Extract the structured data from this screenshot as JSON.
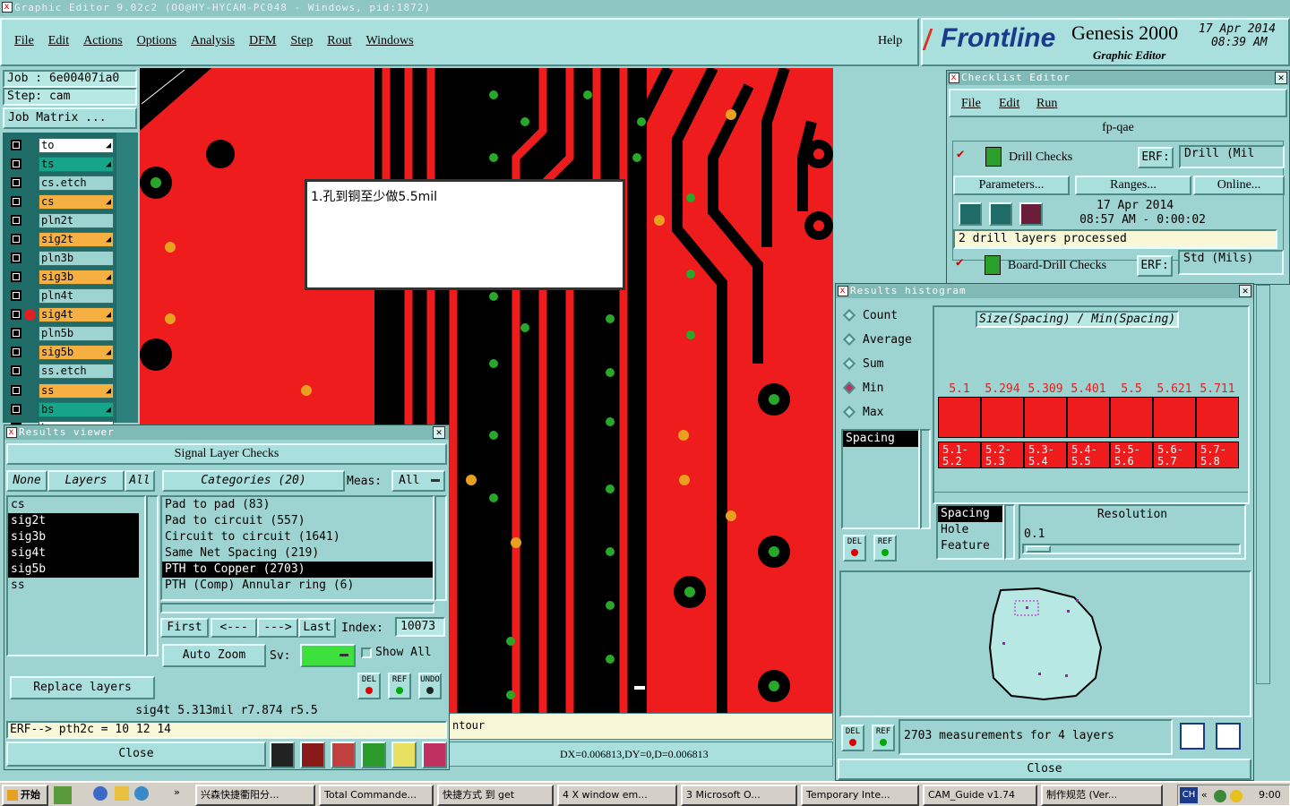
{
  "window": {
    "title": "Graphic Editor 9.02c2  (OO@HY-HYCAM-PC048 - Windows, pid:1872)"
  },
  "menu": {
    "items": [
      "File",
      "Edit",
      "Actions",
      "Options",
      "Analysis",
      "DFM",
      "Step",
      "Rout",
      "Windows"
    ],
    "help": "Help"
  },
  "brand": {
    "logo": "Frontline",
    "product": "Genesis 2000",
    "subtitle": "Graphic Editor",
    "date": "17 Apr 2014",
    "time": "08:39 AM"
  },
  "job": {
    "job_label": "Job : 6e00407ia0",
    "step_label": "Step: cam",
    "matrix_button": "Job Matrix ..."
  },
  "layers": [
    {
      "name": "to",
      "color": "#ffffff",
      "arrow": true
    },
    {
      "name": "ts",
      "color": "#17a589",
      "arrow": true
    },
    {
      "name": "cs.etch",
      "color": "#9dd3d0",
      "arrow": false
    },
    {
      "name": "cs",
      "color": "#f5b041",
      "arrow": true
    },
    {
      "name": "pln2t",
      "color": "#9dd3d0",
      "arrow": false
    },
    {
      "name": "sig2t",
      "color": "#f5b041",
      "arrow": true
    },
    {
      "name": "pln3b",
      "color": "#9dd3d0",
      "arrow": false
    },
    {
      "name": "sig3b",
      "color": "#f5b041",
      "arrow": true
    },
    {
      "name": "pln4t",
      "color": "#9dd3d0",
      "arrow": false
    },
    {
      "name": "sig4t",
      "color": "#f5b041",
      "arrow": true,
      "active": true
    },
    {
      "name": "pln5b",
      "color": "#9dd3d0",
      "arrow": false
    },
    {
      "name": "sig5b",
      "color": "#f5b041",
      "arrow": true
    },
    {
      "name": "ss.etch",
      "color": "#9dd3d0",
      "arrow": false
    },
    {
      "name": "ss",
      "color": "#f5b041",
      "arrow": true
    },
    {
      "name": "bs",
      "color": "#17a589",
      "arrow": true
    },
    {
      "name": "bo",
      "color": "#ffffff",
      "arrow": true
    }
  ],
  "note": {
    "text": "1.孔到铜至少做5.5mil"
  },
  "results_viewer": {
    "title": "Results viewer",
    "header": "Signal Layer Checks",
    "none_btn": "None",
    "layers_btn": "Layers",
    "all_btn": "All",
    "categories_btn": "Categories (20)",
    "meas_label": "Meas:",
    "meas_value": "All",
    "layer_list": [
      {
        "name": "cs",
        "sel": false
      },
      {
        "name": "sig2t",
        "sel": true
      },
      {
        "name": "sig3b",
        "sel": true
      },
      {
        "name": "sig4t",
        "sel": true
      },
      {
        "name": "sig5b",
        "sel": true
      },
      {
        "name": "ss",
        "sel": false
      }
    ],
    "categories": [
      {
        "name": "Pad to pad (83)",
        "sel": false
      },
      {
        "name": "Pad to circuit (557)",
        "sel": false
      },
      {
        "name": "Circuit to circuit (1641)",
        "sel": false
      },
      {
        "name": "Same Net Spacing (219)",
        "sel": false
      },
      {
        "name": "PTH to Copper (2703)",
        "sel": true
      },
      {
        "name": "PTH (Comp) Annular ring (6)",
        "sel": false
      }
    ],
    "first": "First",
    "prev": "<---",
    "next": "--->",
    "last": "Last",
    "index_label": "Index:",
    "index_value": "10073",
    "auto_zoom": "Auto Zoom",
    "sv_label": "Sv:",
    "show_all": "Show All",
    "replace_layers": "Replace layers",
    "status_line": "sig4t 5.313mil  r7.874  r5.5",
    "erf_line": "ERF--> pth2c = 10 12 14",
    "close": "Close"
  },
  "checklist": {
    "title": "Checklist Editor",
    "menu": [
      "File",
      "Edit",
      "Run"
    ],
    "name": "fp-qae",
    "drill": {
      "label": "Drill Checks",
      "erf_label": "ERF:",
      "erf_value": "Drill (Mil",
      "params": "Parameters...",
      "ranges": "Ranges...",
      "online": "Online...",
      "date": "17 Apr 2014",
      "time": "08:57 AM - 0:00:02",
      "status": "2 drill layers processed"
    },
    "board_drill": {
      "label": "Board-Drill Checks",
      "erf_label": "ERF:",
      "erf_value": "Std (Mils)"
    }
  },
  "histogram": {
    "title": "Results histogram",
    "modes": [
      {
        "label": "Count",
        "on": false
      },
      {
        "label": "Average",
        "on": false
      },
      {
        "label": "Sum",
        "on": false
      },
      {
        "label": "Min",
        "on": true
      },
      {
        "label": "Max",
        "on": false
      }
    ],
    "chart_title": "Size(Spacing) / Min(Spacing)",
    "bars": [
      {
        "value": "5.1",
        "range": "5.1-5.2"
      },
      {
        "value": "5.294",
        "range": "5.2-5.3"
      },
      {
        "value": "5.309",
        "range": "5.3-5.4"
      },
      {
        "value": "5.401",
        "range": "5.4-5.5"
      },
      {
        "value": "5.5",
        "range": "5.5-5.6"
      },
      {
        "value": "5.621",
        "range": "5.6-5.7"
      },
      {
        "value": "5.711",
        "range": "5.7-5.8"
      }
    ],
    "type_list": [
      "Spacing"
    ],
    "type_list2": [
      {
        "name": "Spacing",
        "sel": true
      },
      {
        "name": "Hole",
        "sel": false
      },
      {
        "name": "Feature",
        "sel": false
      }
    ],
    "resolution_label": "Resolution",
    "resolution_value": "0.1",
    "summary": "2703 measurements for 4 layers",
    "close": "Close"
  },
  "canvas": {
    "contour_text": "ntour",
    "dxdy": "DX=0.006813,DY=0,D=0.006813"
  },
  "taskbar": {
    "start": "开始",
    "buttons": [
      "兴森快捷衢阳分...",
      "Total Commande...",
      "快捷方式 到 get",
      "4 X window em...",
      "3 Microsoft O...",
      "Temporary Inte...",
      "CAM_Guide v1.74",
      "制作规范 (Ver..."
    ],
    "lang": "CH",
    "clock": "9:00"
  }
}
